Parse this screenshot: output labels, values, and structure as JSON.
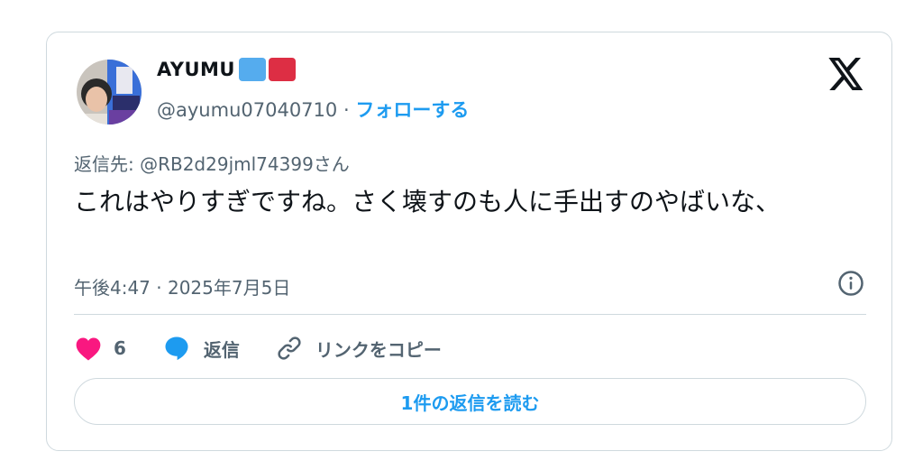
{
  "author": {
    "display_name": "AYUMU",
    "handle": "@ayumu07040710",
    "separator": "·",
    "follow_label": "フォローする",
    "badge_colors": [
      "#55acee",
      "#dd2e44"
    ]
  },
  "tweet": {
    "replying_to": "返信先: @RB2d29jml74399さん",
    "text": "これはやりすぎですね。さく壊すのも人に手出すのやばいな、",
    "timestamp": "午後4:47 · 2025年7月5日"
  },
  "actions": {
    "like_count": "6",
    "reply_label": "返信",
    "copy_link_label": "リンクをコピー"
  },
  "read_replies_label": "1件の返信を読む",
  "colors": {
    "accent": "#1d9bf0",
    "like": "#f91880",
    "secondary_text": "#536471",
    "border": "#cfd9de"
  },
  "icons": [
    "x-logo-icon",
    "info-icon",
    "heart-icon",
    "reply-bubble-icon",
    "link-icon"
  ]
}
